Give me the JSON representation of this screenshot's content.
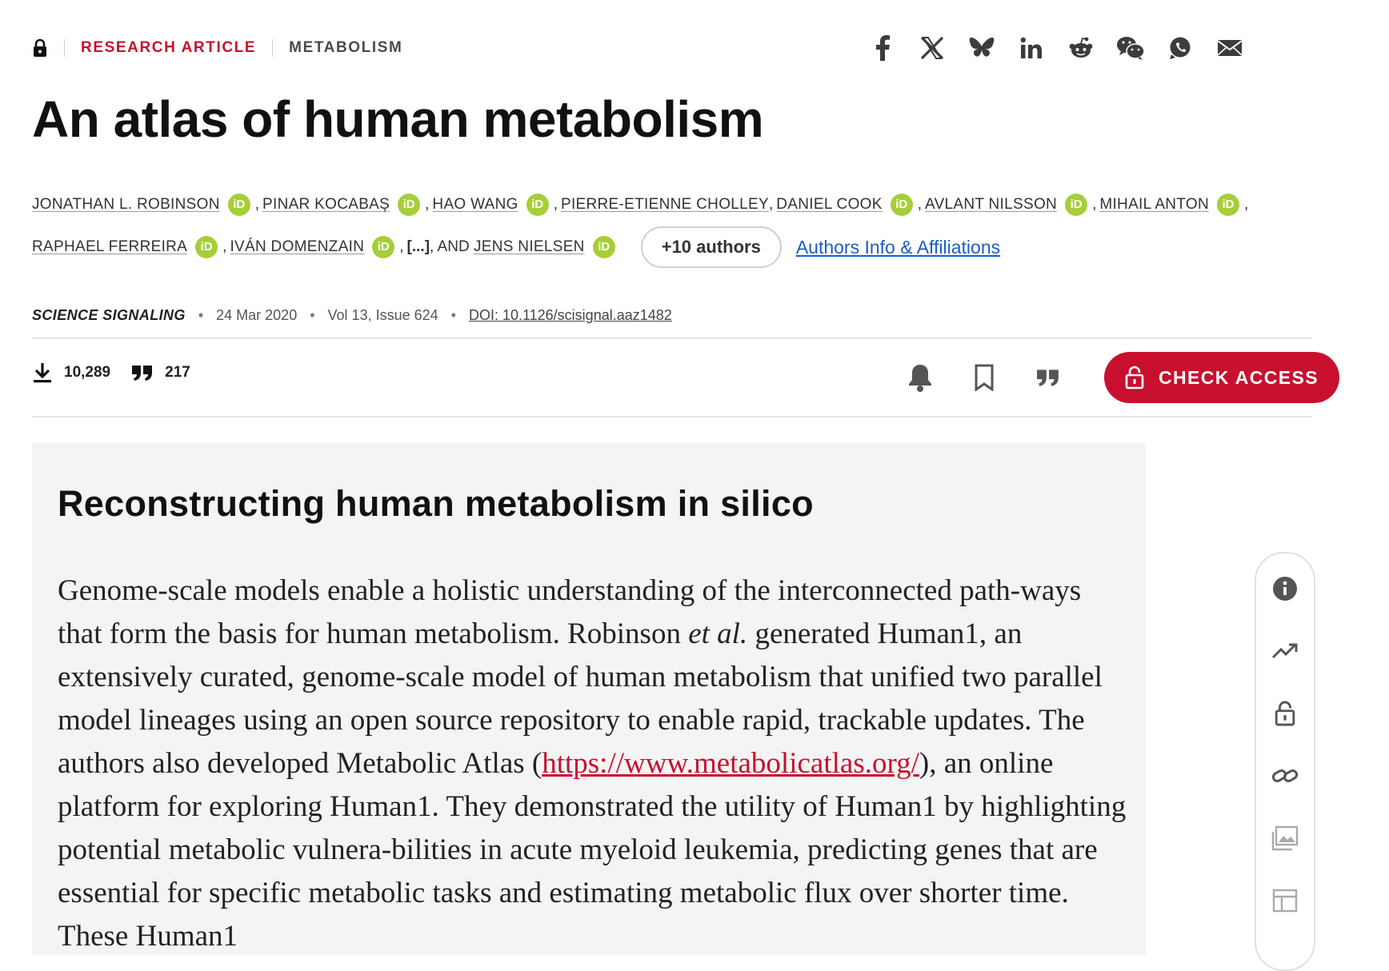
{
  "header": {
    "category": "RESEARCH ARTICLE",
    "subject": "METABOLISM"
  },
  "share_icons": [
    "facebook-icon",
    "x-icon",
    "bluesky-icon",
    "linkedin-icon",
    "reddit-icon",
    "wechat-icon",
    "whatsapp-icon",
    "email-icon"
  ],
  "article": {
    "title": "An atlas of human metabolism",
    "authors_line1": [
      {
        "name": "JONATHAN L. ROBINSON",
        "orcid": true
      },
      {
        "name": "PINAR KOCABAŞ",
        "orcid": true
      },
      {
        "name": "HAO WANG",
        "orcid": true
      },
      {
        "name": "PIERRE-ETIENNE CHOLLEY",
        "orcid": false
      },
      {
        "name": "DANIEL COOK",
        "orcid": true
      },
      {
        "name": "AVLANT NILSSON",
        "orcid": true
      },
      {
        "name": "MIHAIL ANTON",
        "orcid": true
      }
    ],
    "authors_line2": [
      {
        "name": "RAPHAEL FERREIRA",
        "orcid": true
      },
      {
        "name": "IVÁN DOMENZAIN",
        "orcid": true
      }
    ],
    "ellipsis": "[...]",
    "and_text": ", AND ",
    "last_author": "JENS NIELSEN",
    "orcid_label": "iD",
    "more_authors": "+10 authors",
    "affiliations_link": "Authors Info & Affiliations",
    "journal": "SCIENCE SIGNALING",
    "date": "24 Mar 2020",
    "volume": "Vol 13, Issue 624",
    "doi": "DOI: 10.1126/scisignal.aaz1482"
  },
  "metrics": {
    "downloads": "10,289",
    "citations": "217"
  },
  "actions": {
    "check_access": "CHECK ACCESS"
  },
  "summary": {
    "heading": "Reconstructing human metabolism in silico",
    "p1": "Genome-scale models enable a holistic understanding of the interconnected path-ways that form the basis for human metabolism. Robinson ",
    "et_al": "et al.",
    "p2": " generated Human1, an extensively curated, genome-scale model of human metabolism that unified two parallel model lineages using an open source repository to enable rapid, trackable updates. The authors also developed Metabolic Atlas (",
    "link": "https://www.metabolicatlas.org/",
    "p3": "), an online platform for exploring Human1. They demonstrated the utility of Human1 by highlighting potential metabolic vulnera-bilities in acute myeloid leukemia, predicting genes that are essential for specific metabolic tasks and estimating metabolic flux over shorter time. These Human1"
  },
  "rail_icons": [
    "info-icon",
    "trending-icon",
    "unlock-icon",
    "link-icon",
    "image-icon",
    "table-icon"
  ]
}
